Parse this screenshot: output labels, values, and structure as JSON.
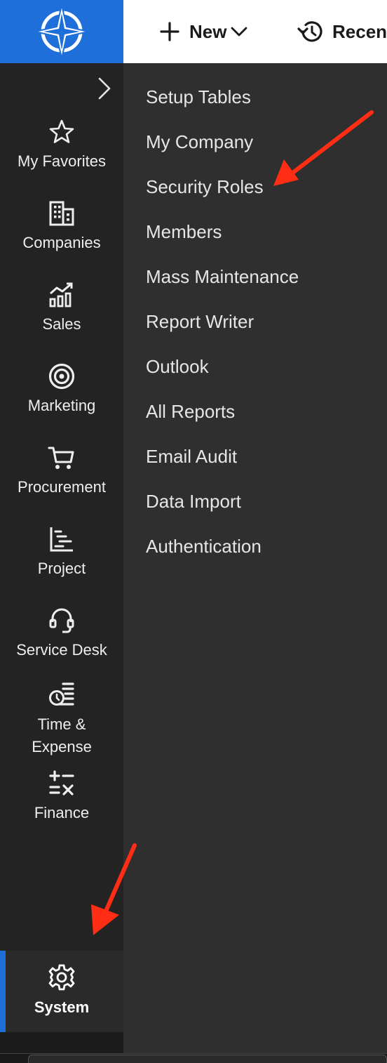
{
  "topbar": {
    "new_label": "New",
    "recent_label": "Recen"
  },
  "sidebar": {
    "items": [
      {
        "label": "My Favorites",
        "icon": "star-icon"
      },
      {
        "label": "Companies",
        "icon": "building-icon"
      },
      {
        "label": "Sales",
        "icon": "sales-chart-icon"
      },
      {
        "label": "Marketing",
        "icon": "target-icon"
      },
      {
        "label": "Procurement",
        "icon": "cart-icon"
      },
      {
        "label": "Project",
        "icon": "project-chart-icon"
      },
      {
        "label": "Service Desk",
        "icon": "headset-icon"
      },
      {
        "label_line1": "Time &",
        "label_line2": "Expense",
        "icon": "time-expense-icon"
      },
      {
        "label": "Finance",
        "icon": "calculator-icon"
      }
    ],
    "system": {
      "label": "System",
      "icon": "gear-icon"
    }
  },
  "submenu": {
    "items": [
      "Setup Tables",
      "My Company",
      "Security Roles",
      "Members",
      "Mass Maintenance",
      "Report Writer",
      "Outlook",
      "All Reports",
      "Email Audit",
      "Data Import",
      "Authentication"
    ]
  },
  "colors": {
    "brand_blue": "#1e6fd9",
    "sidebar_bg": "#232323",
    "submenu_bg": "#2f2f2f",
    "annotation_red": "#ff2d14"
  }
}
